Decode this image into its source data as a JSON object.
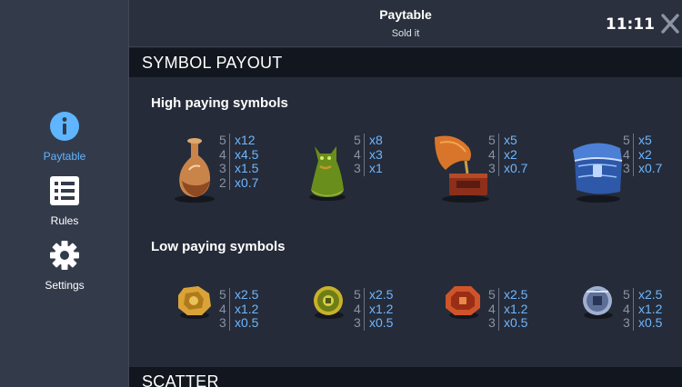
{
  "header": {
    "title": "Paytable",
    "subtitle": "Sold it",
    "clock": "11:11"
  },
  "sidebar": {
    "items": [
      {
        "label": "Paytable",
        "icon": "info-icon",
        "active": true
      },
      {
        "label": "Rules",
        "icon": "list-icon",
        "active": false
      },
      {
        "label": "Settings",
        "icon": "gear-icon",
        "active": false
      }
    ]
  },
  "sections": {
    "symbol_payout": "SYMBOL PAYOUT",
    "scatter": "SCATTER"
  },
  "high": {
    "title": "High paying symbols",
    "symbols": [
      {
        "name": "vase",
        "pays": [
          {
            "count": "5",
            "mult": "x12"
          },
          {
            "count": "4",
            "mult": "x4.5"
          },
          {
            "count": "3",
            "mult": "x1.5"
          },
          {
            "count": "2",
            "mult": "x0.7"
          }
        ]
      },
      {
        "name": "cat",
        "pays": [
          {
            "count": "5",
            "mult": "x8"
          },
          {
            "count": "4",
            "mult": "x3"
          },
          {
            "count": "3",
            "mult": "x1"
          }
        ]
      },
      {
        "name": "gramophone",
        "pays": [
          {
            "count": "5",
            "mult": "x5"
          },
          {
            "count": "4",
            "mult": "x2"
          },
          {
            "count": "3",
            "mult": "x0.7"
          }
        ]
      },
      {
        "name": "chest",
        "pays": [
          {
            "count": "5",
            "mult": "x5"
          },
          {
            "count": "4",
            "mult": "x2"
          },
          {
            "count": "3",
            "mult": "x0.7"
          }
        ]
      }
    ]
  },
  "low": {
    "title": "Low paying symbols",
    "symbols": [
      {
        "name": "gold-coin",
        "pays": [
          {
            "count": "5",
            "mult": "x2.5"
          },
          {
            "count": "4",
            "mult": "x1.2"
          },
          {
            "count": "3",
            "mult": "x0.5"
          }
        ]
      },
      {
        "name": "green-coin",
        "pays": [
          {
            "count": "5",
            "mult": "x2.5"
          },
          {
            "count": "4",
            "mult": "x1.2"
          },
          {
            "count": "3",
            "mult": "x0.5"
          }
        ]
      },
      {
        "name": "red-coin",
        "pays": [
          {
            "count": "5",
            "mult": "x2.5"
          },
          {
            "count": "4",
            "mult": "x1.2"
          },
          {
            "count": "3",
            "mult": "x0.5"
          }
        ]
      },
      {
        "name": "silver-coin",
        "pays": [
          {
            "count": "5",
            "mult": "x2.5"
          },
          {
            "count": "4",
            "mult": "x1.2"
          },
          {
            "count": "3",
            "mult": "x0.5"
          }
        ]
      }
    ]
  },
  "colors": {
    "accent": "#5fb5ff",
    "multiplier": "#6fb6ff",
    "sidebar": "#333b4b",
    "background": "#252b38"
  }
}
